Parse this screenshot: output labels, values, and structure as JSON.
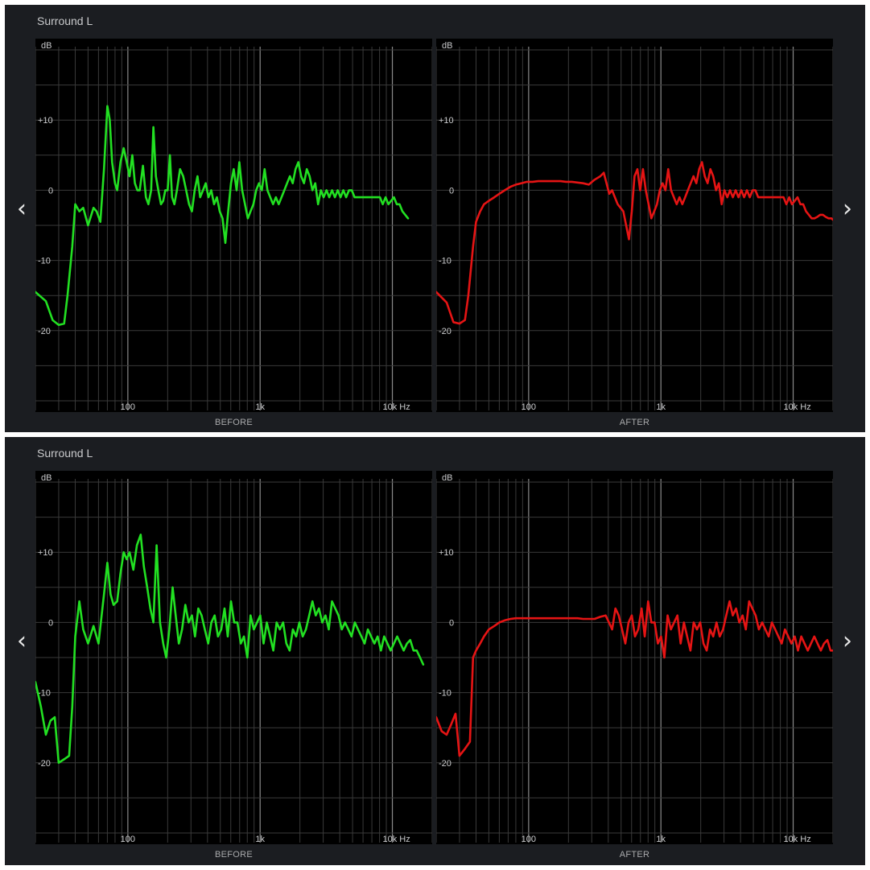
{
  "colors": {
    "panel_bg": "#1b1d21",
    "plot_bg": "#000000",
    "before_line": "#22e022",
    "after_line": "#e51414",
    "grid": "#3a3a3a",
    "grid_decade": "#8a8a8a",
    "text": "#c9cacc"
  },
  "nav": {
    "prev_icon": "chevron-left-icon",
    "next_icon": "chevron-right-icon",
    "prev_glyph": "‹",
    "next_glyph": "›"
  },
  "panels": [
    {
      "title": "Surround L",
      "before_label": "BEFORE",
      "after_label": "AFTER"
    },
    {
      "title": "Surround L",
      "before_label": "BEFORE",
      "after_label": "AFTER"
    }
  ],
  "chart_data": [
    {
      "type": "line",
      "xscale": "log",
      "xlim": [
        20,
        20000
      ],
      "ylim": [
        -30,
        20
      ],
      "xlabel": "",
      "ylabel": "dB",
      "grid": true,
      "x_ticks": [
        {
          "v": 100,
          "label": "100"
        },
        {
          "v": 1000,
          "label": "1k"
        },
        {
          "v": 10000,
          "label": "10k Hz"
        }
      ],
      "y_ticks": [
        {
          "v": 10,
          "label": "+10"
        },
        {
          "v": 0,
          "label": "0"
        },
        {
          "v": -10,
          "label": "-10"
        },
        {
          "v": -20,
          "label": "-20"
        }
      ],
      "panels": [
        {
          "label": "BEFORE",
          "color": "#22e022",
          "x": [
            20,
            24,
            27,
            30,
            33,
            35,
            38,
            40,
            43,
            46,
            50,
            55,
            58,
            62,
            66,
            70,
            73,
            76,
            80,
            83,
            88,
            93,
            98,
            103,
            108,
            113,
            118,
            123,
            130,
            137,
            143,
            150,
            156,
            163,
            170,
            178,
            185,
            192,
            200,
            208,
            216,
            225,
            235,
            248,
            262,
            276,
            290,
            305,
            320,
            336,
            352,
            370,
            388,
            407,
            427,
            449,
            471,
            495,
            520,
            546,
            573,
            602,
            632,
            664,
            697,
            732,
            768,
            807,
            847,
            890,
            934,
            981,
            1030,
            1082,
            1136,
            1193,
            1253,
            1316,
            1382,
            1451,
            1524,
            1600,
            1680,
            1765,
            1853,
            1946,
            2044,
            2146,
            2254,
            2367,
            2485,
            2610,
            2741,
            2879,
            3023,
            3175,
            3334,
            3501,
            3677,
            3862,
            4056,
            4259,
            4473,
            4698,
            4933,
            5181,
            5441,
            5714,
            6001,
            6302,
            6618,
            6951,
            7300,
            7666,
            8051,
            8455,
            8880,
            9326,
            9794,
            10285,
            10802,
            11344,
            11913,
            12511,
            13139,
            13799,
            14491,
            15218,
            15982,
            16785,
            17627,
            18513,
            19442,
            20000
          ],
          "y": [
            -14.5,
            -15.8,
            -18.5,
            -19.2,
            -19,
            -15,
            -8,
            -2,
            -3,
            -2.5,
            -5,
            -2.5,
            -3,
            -4.5,
            3,
            12,
            10,
            4,
            1,
            0,
            4,
            6,
            4,
            2,
            5,
            1,
            0,
            0,
            3.5,
            -1,
            -2,
            0,
            9,
            2,
            0,
            -2,
            -1.5,
            0,
            0,
            5,
            -1,
            -2,
            0,
            3,
            2,
            0,
            -2,
            -3,
            0,
            2,
            -1,
            0,
            1,
            -1,
            0,
            -2,
            -1,
            -3,
            -4,
            -7.5,
            -3,
            1,
            3,
            0,
            4,
            0,
            -2,
            -4,
            -3,
            -2,
            0,
            1,
            0,
            3,
            0,
            -1,
            -2,
            -1,
            -2,
            -1,
            0,
            1,
            2,
            1,
            3,
            4,
            2,
            1,
            3,
            2,
            0,
            1,
            -2,
            0,
            -1,
            0,
            -1,
            0,
            -1,
            0,
            -1,
            0,
            -1,
            0,
            0,
            -1,
            -1,
            -1,
            -1,
            -1,
            -1,
            -1,
            -1,
            -1,
            -1,
            -2,
            -1,
            -2,
            -1.5,
            -1,
            -2,
            -2,
            -3,
            -3.5,
            -4
          ]
        },
        {
          "label": "AFTER",
          "color": "#e51414",
          "x": [
            20,
            24,
            27,
            30,
            33,
            35,
            38,
            40,
            43,
            46,
            50,
            55,
            60,
            66,
            73,
            80,
            88,
            97,
            107,
            118,
            130,
            143,
            158,
            174,
            192,
            212,
            234,
            258,
            285,
            315,
            348,
            370,
            388,
            407,
            427,
            449,
            471,
            495,
            520,
            546,
            573,
            602,
            632,
            664,
            697,
            732,
            768,
            807,
            847,
            890,
            934,
            981,
            1030,
            1082,
            1136,
            1193,
            1253,
            1316,
            1382,
            1451,
            1524,
            1600,
            1680,
            1765,
            1853,
            1946,
            2044,
            2146,
            2254,
            2367,
            2485,
            2610,
            2741,
            2879,
            3023,
            3175,
            3334,
            3501,
            3677,
            3862,
            4056,
            4259,
            4473,
            4698,
            4933,
            5181,
            5441,
            5714,
            6001,
            6302,
            6618,
            6951,
            7300,
            7666,
            8051,
            8455,
            8880,
            9326,
            9794,
            10285,
            10802,
            11344,
            11913,
            12511,
            13139,
            13799,
            14491,
            15218,
            15982,
            16785,
            17627,
            18513,
            19442,
            20000
          ],
          "y": [
            -14.5,
            -16,
            -18.8,
            -19,
            -18.5,
            -15,
            -8,
            -4.5,
            -3,
            -2,
            -1.5,
            -1,
            -0.5,
            0,
            0.5,
            0.8,
            1,
            1.2,
            1.2,
            1.3,
            1.3,
            1.3,
            1.3,
            1.3,
            1.2,
            1.2,
            1.1,
            1,
            0.8,
            1.5,
            2,
            2.5,
            1,
            -0.5,
            0,
            -1,
            -2,
            -2.5,
            -3,
            -5,
            -7,
            -3,
            2,
            3,
            0,
            3,
            0,
            -2,
            -4,
            -3,
            -2,
            0,
            1,
            0,
            3,
            0,
            -1,
            -2,
            -1,
            -2,
            -1,
            0,
            1,
            2,
            1,
            3,
            4,
            2,
            1,
            3,
            2,
            0,
            1,
            -2,
            0,
            -1,
            0,
            -1,
            0,
            -1,
            0,
            -1,
            0,
            -1,
            0,
            0,
            -1,
            -1,
            -1,
            -1,
            -1,
            -1,
            -1,
            -1,
            -1,
            -1,
            -2,
            -1,
            -2,
            -1.5,
            -1,
            -2,
            -2,
            -3,
            -3.5,
            -4,
            -4,
            -3.8,
            -3.5,
            -3.5,
            -3.8,
            -4,
            -4,
            -4.2,
            -4.2,
            -4.2
          ]
        }
      ]
    },
    {
      "type": "line",
      "xscale": "log",
      "xlim": [
        20,
        20000
      ],
      "ylim": [
        -30,
        20
      ],
      "xlabel": "",
      "ylabel": "dB",
      "grid": true,
      "x_ticks": [
        {
          "v": 100,
          "label": "100"
        },
        {
          "v": 1000,
          "label": "1k"
        },
        {
          "v": 10000,
          "label": "10k Hz"
        }
      ],
      "y_ticks": [
        {
          "v": 10,
          "label": "+10"
        },
        {
          "v": 0,
          "label": "0"
        },
        {
          "v": -10,
          "label": "-10"
        },
        {
          "v": -20,
          "label": "-20"
        }
      ],
      "panels": [
        {
          "label": "BEFORE",
          "color": "#22e022",
          "x": [
            20,
            22,
            24,
            26,
            28,
            30,
            33,
            36,
            38,
            40,
            43,
            46,
            50,
            55,
            60,
            66,
            70,
            74,
            78,
            83,
            88,
            93,
            98,
            103,
            110,
            117,
            125,
            132,
            140,
            148,
            156,
            165,
            175,
            185,
            195,
            206,
            218,
            230,
            243,
            257,
            272,
            288,
            305,
            322,
            341,
            361,
            382,
            405,
            428,
            453,
            480,
            508,
            538,
            569,
            602,
            637,
            674,
            714,
            755,
            800,
            846,
            896,
            948,
            1003,
            1062,
            1124,
            1189,
            1259,
            1332,
            1410,
            1492,
            1580,
            1672,
            1770,
            1873,
            1982,
            2098,
            2220,
            2350,
            2487,
            2633,
            2786,
            2949,
            3121,
            3303,
            3496,
            3700,
            3916,
            4145,
            4387,
            4643,
            4914,
            5201,
            5504,
            5826,
            6166,
            6526,
            6907,
            7310,
            7737,
            8188,
            8666,
            9172,
            9708,
            10275,
            10874,
            11509,
            12181,
            12892,
            13645,
            14441,
            15284,
            16177,
            17121,
            18121,
            19179,
            20000
          ],
          "y": [
            -8.5,
            -12,
            -16,
            -14,
            -13.5,
            -20,
            -19.5,
            -19,
            -12,
            -2,
            3,
            -1,
            -3,
            -0.5,
            -3,
            4,
            8.5,
            4,
            2.5,
            3,
            7,
            10,
            9,
            10,
            7.5,
            11,
            12.5,
            8,
            5,
            2,
            0,
            11,
            0,
            -3,
            -5,
            -1,
            5,
            1,
            -3,
            -1,
            2.5,
            0,
            1,
            -2,
            2,
            1,
            -1,
            -3,
            0,
            1,
            -2,
            -1,
            2,
            -2,
            3,
            0,
            0,
            -3,
            -2,
            -5,
            1,
            -1,
            0,
            1,
            -3,
            0,
            -2,
            -4,
            0,
            -1,
            0,
            -3,
            -4,
            -1,
            -2,
            0,
            -2,
            -1,
            1,
            3,
            1,
            2,
            0,
            1,
            -1,
            3,
            2,
            1,
            -1,
            0,
            -1,
            -2,
            0,
            -1,
            -2,
            -3,
            -1,
            -2,
            -3,
            -2,
            -4,
            -2,
            -3,
            -4,
            -3,
            -2,
            -3,
            -4,
            -3,
            -2.5,
            -4,
            -4,
            -5,
            -6
          ]
        },
        {
          "label": "AFTER",
          "color": "#e51414",
          "x": [
            20,
            22,
            24,
            26,
            28,
            30,
            33,
            36,
            38,
            40,
            43,
            46,
            50,
            55,
            60,
            66,
            73,
            80,
            88,
            97,
            107,
            118,
            130,
            143,
            158,
            174,
            192,
            212,
            234,
            258,
            285,
            315,
            348,
            382,
            405,
            428,
            453,
            480,
            508,
            538,
            569,
            602,
            637,
            674,
            714,
            755,
            800,
            846,
            896,
            948,
            1003,
            1062,
            1124,
            1189,
            1259,
            1332,
            1410,
            1492,
            1580,
            1672,
            1770,
            1873,
            1982,
            2098,
            2220,
            2350,
            2487,
            2633,
            2786,
            2949,
            3121,
            3303,
            3496,
            3700,
            3916,
            4145,
            4387,
            4643,
            4914,
            5201,
            5504,
            5826,
            6166,
            6526,
            6907,
            7310,
            7737,
            8188,
            8666,
            9172,
            9708,
            10275,
            10874,
            11509,
            12181,
            12892,
            13645,
            14441,
            15284,
            16177,
            17121,
            18121,
            19179,
            20000
          ],
          "y": [
            -13.5,
            -15.5,
            -16,
            -14.5,
            -13,
            -19,
            -18,
            -17,
            -5,
            -4,
            -3,
            -2,
            -1,
            -0.5,
            0,
            0.3,
            0.5,
            0.6,
            0.6,
            0.6,
            0.6,
            0.6,
            0.6,
            0.6,
            0.6,
            0.6,
            0.6,
            0.6,
            0.6,
            0.5,
            0.5,
            0.5,
            0.8,
            1,
            0,
            -1,
            2,
            1,
            -1,
            -3,
            0,
            1,
            -2,
            -1,
            2,
            -2,
            3,
            0,
            0,
            -3,
            -2,
            -5,
            1,
            -1,
            0,
            1,
            -3,
            0,
            -2,
            -4,
            0,
            -1,
            0,
            -3,
            -4,
            -1,
            -2,
            0,
            -2,
            -1,
            1,
            3,
            1,
            2,
            0,
            1,
            -1,
            3,
            2,
            1,
            -1,
            0,
            -1,
            -2,
            0,
            -1,
            -2,
            -3,
            -1,
            -2,
            -3,
            -2,
            -4,
            -2,
            -3,
            -4,
            -3,
            -2,
            -3,
            -4,
            -3,
            -2.5,
            -4,
            -4,
            -5,
            -6
          ]
        }
      ]
    }
  ]
}
